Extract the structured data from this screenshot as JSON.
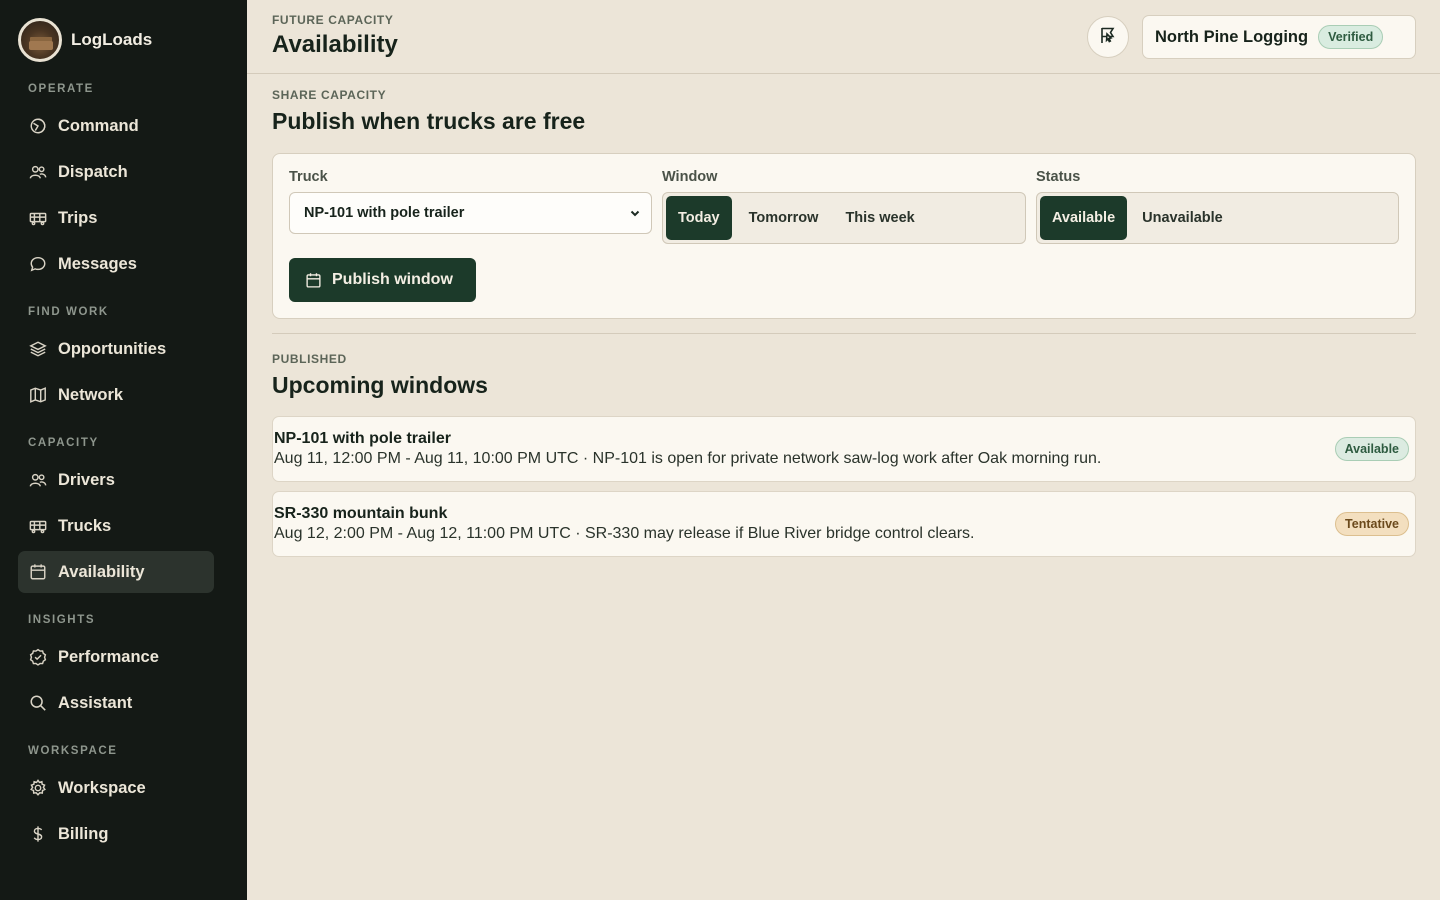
{
  "brand": {
    "name": "LogLoads"
  },
  "sidebar": {
    "sections": [
      {
        "label": "OPERATE",
        "items": [
          {
            "label": "Command",
            "icon": "command-icon"
          },
          {
            "label": "Dispatch",
            "icon": "users-icon"
          },
          {
            "label": "Trips",
            "icon": "truck-icon"
          },
          {
            "label": "Messages",
            "icon": "message-icon"
          }
        ]
      },
      {
        "label": "FIND WORK",
        "items": [
          {
            "label": "Opportunities",
            "icon": "layers-icon"
          },
          {
            "label": "Network",
            "icon": "map-icon"
          }
        ]
      },
      {
        "label": "CAPACITY",
        "items": [
          {
            "label": "Drivers",
            "icon": "users-icon"
          },
          {
            "label": "Trucks",
            "icon": "truck-icon"
          },
          {
            "label": "Availability",
            "icon": "calendar-icon",
            "active": true
          }
        ]
      },
      {
        "label": "INSIGHTS",
        "items": [
          {
            "label": "Performance",
            "icon": "badge-check-icon"
          },
          {
            "label": "Assistant",
            "icon": "search-icon"
          }
        ]
      },
      {
        "label": "WORKSPACE",
        "items": [
          {
            "label": "Workspace",
            "icon": "gear-icon"
          },
          {
            "label": "Billing",
            "icon": "dollar-icon"
          }
        ]
      }
    ]
  },
  "header": {
    "eyebrow": "FUTURE CAPACITY",
    "title": "Availability",
    "org_name": "North Pine Logging",
    "org_badge": "Verified"
  },
  "share": {
    "eyebrow": "SHARE CAPACITY",
    "title": "Publish when trucks are free",
    "truck_label": "Truck",
    "truck_value": "NP-101 with pole trailer",
    "window_label": "Window",
    "window_options": [
      "Today",
      "Tomorrow",
      "This week"
    ],
    "window_selected": "Today",
    "status_label": "Status",
    "status_options": [
      "Available",
      "Unavailable"
    ],
    "status_selected": "Available",
    "publish_label": "Publish window"
  },
  "published": {
    "eyebrow": "PUBLISHED",
    "title": "Upcoming windows",
    "rows": [
      {
        "title": "NP-101 with pole trailer",
        "detail": "Aug 11, 12:00 PM - Aug 11, 10:00 PM UTC · NP-101 is open for private network saw-log work after Oak morning run.",
        "status": "Available"
      },
      {
        "title": "SR-330 mountain bunk",
        "detail": "Aug 12, 2:00 PM - Aug 12, 11:00 PM UTC · SR-330 may release if Blue River bridge control clears.",
        "status": "Tentative"
      }
    ]
  },
  "colors": {
    "sidebar_bg": "#141915",
    "page_bg": "#ece5d8",
    "accent": "#1c3a2a"
  }
}
